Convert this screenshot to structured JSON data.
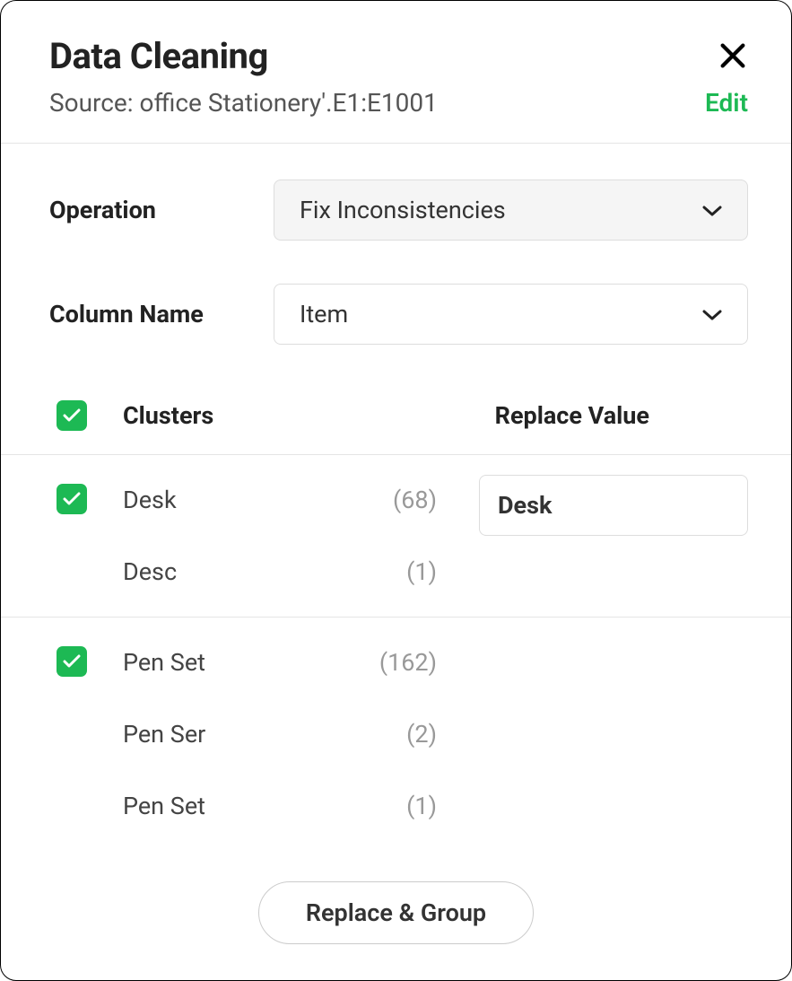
{
  "header": {
    "title": "Data Cleaning",
    "source_prefix": "Source: ",
    "source_value": "office Stationery'.E1:E1001",
    "edit_label": "Edit"
  },
  "form": {
    "operation_label": "Operation",
    "operation_value": "Fix Inconsistencies",
    "column_label": "Column Name",
    "column_value": "Item"
  },
  "table": {
    "header_clusters": "Clusters",
    "header_replace": "Replace Value"
  },
  "clusters": [
    {
      "checked": true,
      "items": [
        {
          "name": "Desk",
          "count": "(68)"
        },
        {
          "name": "Desc",
          "count": "(1)"
        }
      ],
      "replace_value": "Desk"
    },
    {
      "checked": true,
      "items": [
        {
          "name": "Pen Set",
          "count": "(162)"
        },
        {
          "name": "Pen Ser",
          "count": "(2)"
        },
        {
          "name": "Pen Set",
          "count": "(1)"
        }
      ],
      "replace_value": ""
    }
  ],
  "footer": {
    "action_label": "Replace & Group"
  },
  "colors": {
    "accent": "#1db954"
  }
}
